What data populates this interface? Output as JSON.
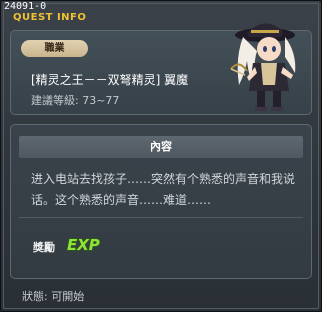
{
  "window": {
    "quest_id": "24091-0",
    "title": "QUEST INFO"
  },
  "header": {
    "job_badge": "職業",
    "quest_name": "[精灵之王－－双弩精灵] 翼魔",
    "level_range": "建議等級: 73~77"
  },
  "content": {
    "section_title": "內容",
    "description_line1": "进入电站去找孩子……突然有个熟悉的声音和我说",
    "description_line2": "话。这个熟悉的声音……难道……",
    "reward_label": "獎勵",
    "reward_icon": "exp-icon",
    "reward_icon_text": "EXP"
  },
  "status": {
    "text": "狀態:  可開始"
  },
  "colors": {
    "title": "#f0c233",
    "badge": "#d6c4a0",
    "exp_green": "#8fe23a"
  }
}
